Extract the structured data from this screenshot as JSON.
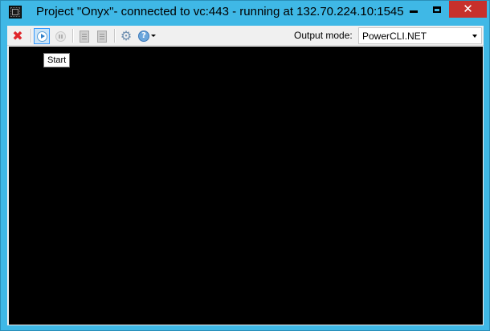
{
  "window": {
    "title": "Project \"Onyx\"- connected to vc:443 - running at 132.70.224.10:1545",
    "close_glyph": "✕"
  },
  "toolbar": {
    "buttons": [
      {
        "name": "stop-icon",
        "glyph": "✖"
      },
      {
        "name": "start-icon",
        "state": "hover"
      },
      {
        "name": "pause-icon",
        "state": "disabled"
      },
      {
        "name": "copy-icon",
        "state": "disabled"
      },
      {
        "name": "export-icon",
        "state": "disabled"
      },
      {
        "name": "settings-gear-icon",
        "glyph": "⚙"
      },
      {
        "name": "help-icon",
        "glyph": "?"
      }
    ],
    "output_mode_label": "Output mode:",
    "output_mode_value": "PowerCLI.NET"
  },
  "tooltip": {
    "text": "Start"
  },
  "colors": {
    "frame": "#3fb8e6",
    "close_button": "#c7302b",
    "output_background": "#000000",
    "accent": "#3399ff"
  }
}
